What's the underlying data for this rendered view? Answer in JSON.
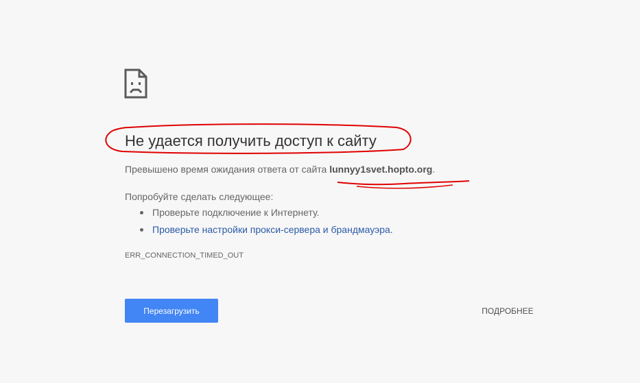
{
  "error": {
    "icon": "sad-page-icon",
    "title": "Не удается получить доступ к сайту",
    "message_prefix": "Превышено время ожидания ответа от сайта ",
    "host": "lunnyy1svet.hopto.org",
    "message_suffix": ".",
    "suggestions_heading": "Попробуйте сделать следующее:",
    "suggestions": [
      {
        "label": "Проверьте подключение к Интернету.",
        "link": false
      },
      {
        "label": "Проверьте настройки прокси-сервера и брандмауэра.",
        "link": true
      }
    ],
    "code": "ERR_CONNECTION_TIMED_OUT"
  },
  "buttons": {
    "reload_label": "Перезагрузить",
    "details_label": "ПОДРОБНЕЕ"
  },
  "colors": {
    "background": "#f7f7f7",
    "primary_button": "#4285f4",
    "link": "#2b5aa8",
    "annotation": "#e00000"
  }
}
